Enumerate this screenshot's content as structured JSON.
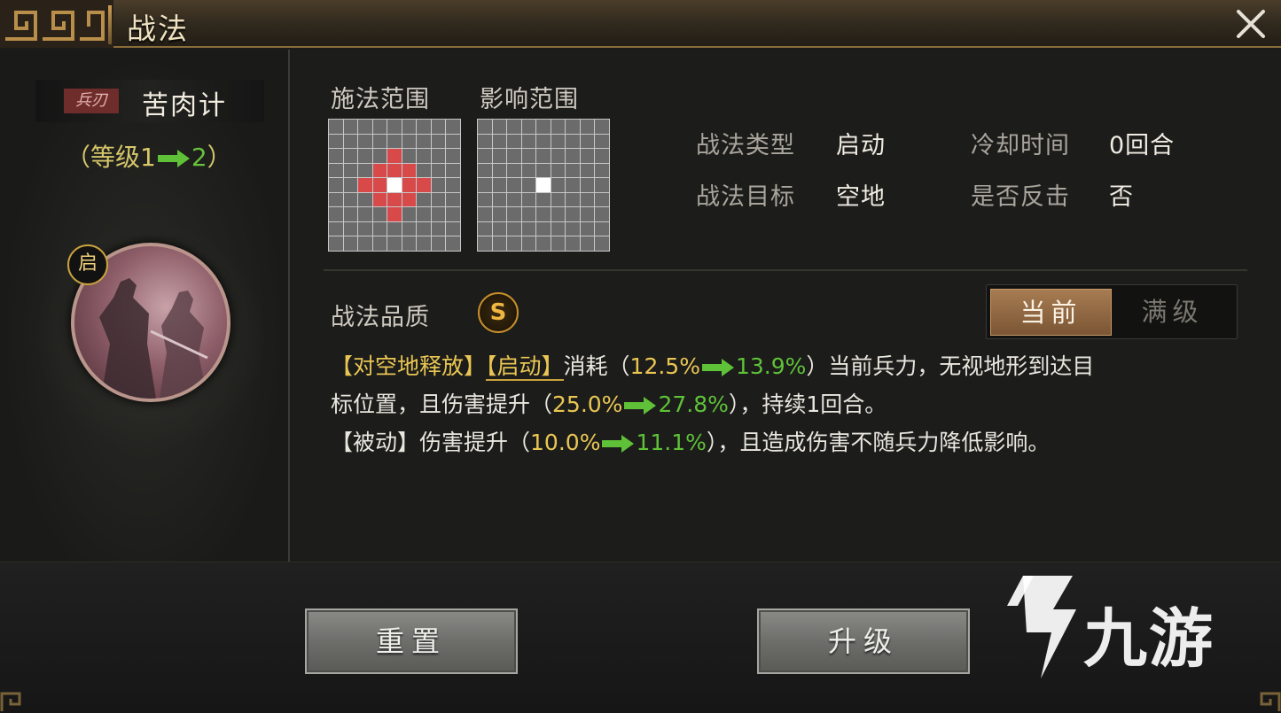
{
  "window": {
    "title": "战法",
    "close_icon": "close-icon"
  },
  "skill": {
    "troop_tag": "兵刃",
    "name": "苦肉计",
    "level_prefix": "（等级1",
    "level_to": "2",
    "level_suffix": "）",
    "portrait_badge": "启"
  },
  "ranges": {
    "cast_label": "施法范围",
    "effect_label": "影响范围",
    "grid_size": 9,
    "cast_highlight_cells": [
      [
        2,
        4
      ],
      [
        3,
        3
      ],
      [
        3,
        4
      ],
      [
        3,
        5
      ],
      [
        4,
        2
      ],
      [
        4,
        3
      ],
      [
        4,
        5
      ],
      [
        4,
        6
      ],
      [
        5,
        3
      ],
      [
        5,
        4
      ],
      [
        5,
        5
      ],
      [
        6,
        4
      ]
    ],
    "cast_center_cell": [
      4,
      4
    ],
    "effect_highlight_cells": [],
    "effect_center_cell": [
      4,
      4
    ]
  },
  "attributes": {
    "type_label": "战法类型",
    "type_value": "启动",
    "cooldown_label": "冷却时间",
    "cooldown_value": "0回合",
    "target_label": "战法目标",
    "target_value": "空地",
    "counter_label": "是否反击",
    "counter_value": "否"
  },
  "quality": {
    "label": "战法品质",
    "grade": "S"
  },
  "view_toggle": {
    "current": "当前",
    "max": "满级"
  },
  "description": {
    "l1_tag1": "【对空地释放】",
    "l1_tag2": "【启动】",
    "l1_t1": "消耗（",
    "l1_v1": "12.5%",
    "l1_v2": "13.9%",
    "l1_t2": "）当前兵力，无视地形到达目",
    "l2_t1": "标位置，且伤害提升（",
    "l2_v1": "25.0%",
    "l2_v2": "27.8%",
    "l2_t2": "），持续1回合。",
    "l3_tag": "【被动】",
    "l3_t1": "伤害提升（",
    "l3_v1": "10.0%",
    "l3_v2": "11.1%",
    "l3_t2": "），且造成伤害不随兵力降低影响。"
  },
  "buttons": {
    "reset": "重置",
    "upgrade": "升级"
  },
  "watermark": {
    "text": "九游"
  }
}
